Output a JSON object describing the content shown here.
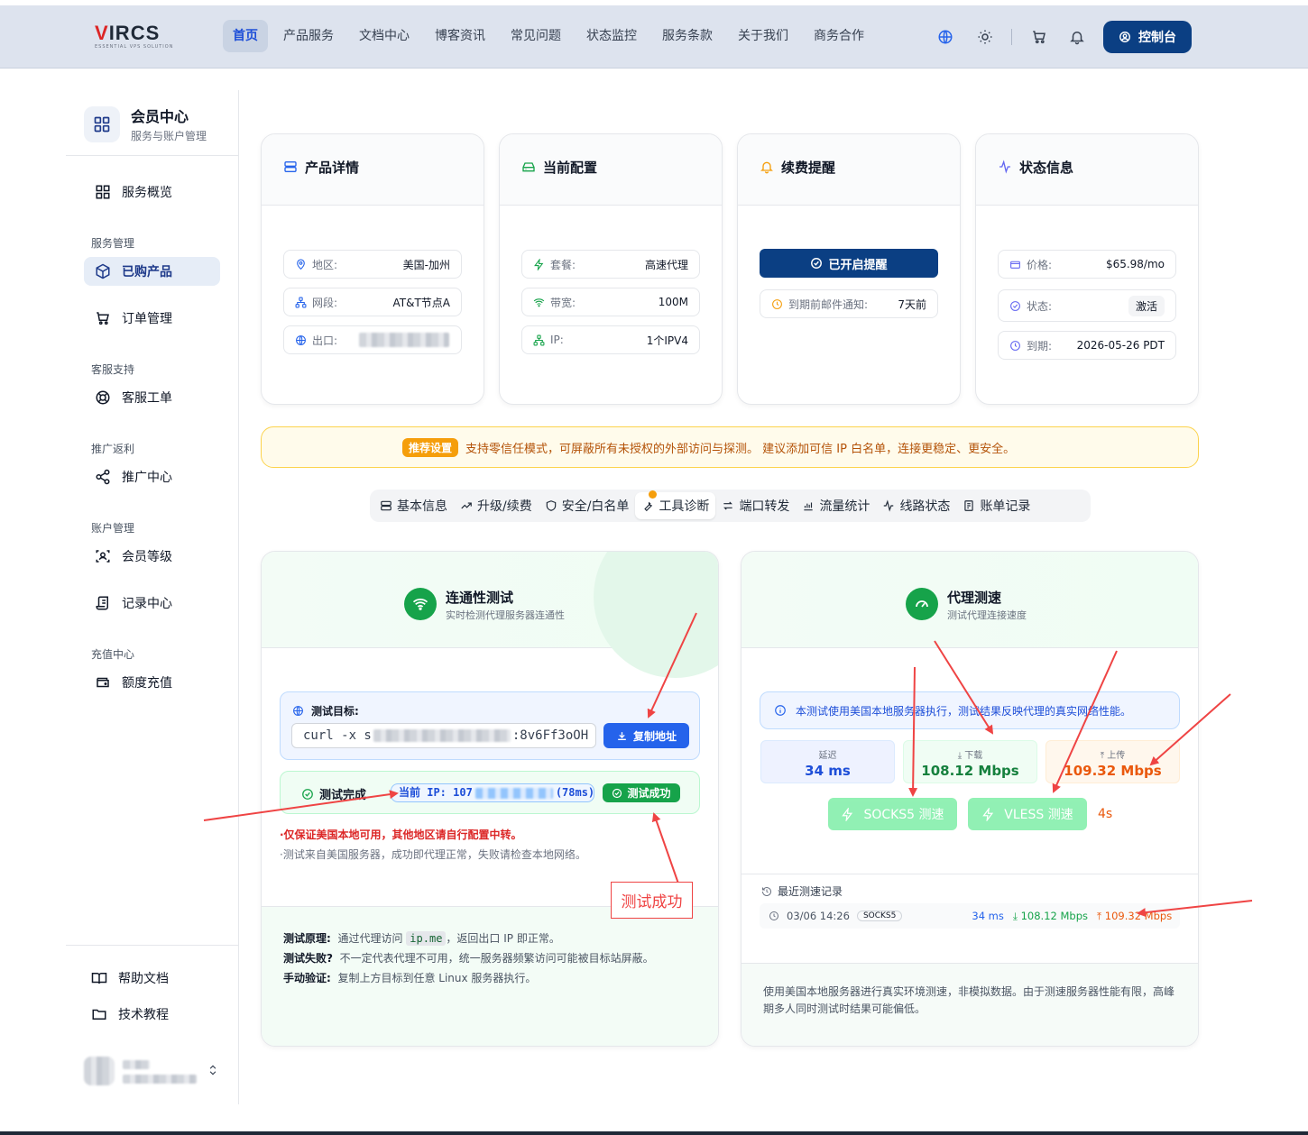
{
  "brand": {
    "name_prefix": "V",
    "name_rest": "IRCS",
    "tagline": "ESSENTIAL VPS SOLUTION"
  },
  "nav": [
    {
      "label": "首页",
      "active": true
    },
    {
      "label": "产品服务"
    },
    {
      "label": "文档中心"
    },
    {
      "label": "博客资讯"
    },
    {
      "label": "常见问题"
    },
    {
      "label": "状态监控"
    },
    {
      "label": "服务条款"
    },
    {
      "label": "关于我们"
    },
    {
      "label": "商务合作"
    }
  ],
  "header": {
    "console_label": "控制台",
    "icons": [
      "globe-icon",
      "sun-icon",
      "cart-icon",
      "bell-icon"
    ]
  },
  "sidebar": {
    "title": "会员中心",
    "subtitle": "服务与账户管理",
    "overview": "服务概览",
    "groups": {
      "service": "服务管理",
      "support": "客服支持",
      "promo": "推广返利",
      "account": "账户管理",
      "recharge": "充值中心"
    },
    "items": {
      "purchased": "已购产品",
      "orders": "订单管理",
      "tickets": "客服工单",
      "promo_center": "推广中心",
      "level": "会员等级",
      "records": "记录中心",
      "topup": "额度充值"
    },
    "bottom": {
      "help": "帮助文档",
      "tutorial": "技术教程"
    }
  },
  "cards": {
    "product": {
      "title": "产品详情",
      "rows": [
        {
          "label": "地区:",
          "value": "美国-加州"
        },
        {
          "label": "网段:",
          "value": "AT&T节点A"
        },
        {
          "label": "出口:",
          "value": ""
        }
      ]
    },
    "config": {
      "title": "当前配置",
      "rows": [
        {
          "label": "套餐:",
          "value": "高速代理"
        },
        {
          "label": "带宽:",
          "value": "100M"
        },
        {
          "label": "IP:",
          "value": "1个IPV4"
        }
      ]
    },
    "renew": {
      "title": "续费提醒",
      "button": "已开启提醒",
      "row": {
        "label": "到期前邮件通知:",
        "value": "7天前"
      }
    },
    "status": {
      "title": "状态信息",
      "rows": [
        {
          "label": "价格:",
          "value": "$65.98/mo"
        },
        {
          "label": "状态:",
          "value": "激活"
        },
        {
          "label": "到期:",
          "value": "2026-05-26 PDT"
        }
      ]
    }
  },
  "notice": {
    "tag": "推荐设置",
    "text": "支持零信任模式，可屏蔽所有未授权的外部访问与探测。 建议添加可信 IP 白名单，连接更稳定、更安全。"
  },
  "tabs": [
    {
      "label": "基本信息",
      "icon": "server-icon"
    },
    {
      "label": "升级/续费",
      "icon": "trend-icon"
    },
    {
      "label": "安全/白名单",
      "icon": "shield-icon"
    },
    {
      "label": "工具诊断",
      "icon": "wrench-icon",
      "active": true
    },
    {
      "label": "端口转发",
      "icon": "swap-icon"
    },
    {
      "label": "流量统计",
      "icon": "bar-icon"
    },
    {
      "label": "线路状态",
      "icon": "pulse-icon"
    },
    {
      "label": "账单记录",
      "icon": "receipt-icon"
    }
  ],
  "connectivity": {
    "title": "连通性测试",
    "subtitle": "实时检测代理服务器连通性",
    "target_label": "测试目标:",
    "command_prefix": "curl -x s",
    "command_suffix": ":8v6Ff3oOH",
    "copy_button": "复制地址",
    "done_label": "测试完成",
    "ip_prefix": "当前 IP: 107",
    "ip_suffix": "(78ms)",
    "success_badge": "测试成功",
    "warn_note": "·仅保证美国本地可用，其他地区请自行配置中转。",
    "info_note": "·测试来自美国服务器，成功即代理正常，失败请检查本地网络。",
    "principle_label": "测试原理:",
    "principle_pre": "通过代理访问",
    "principle_code": "ip.me",
    "principle_post": "，返回出口 IP 即正常。",
    "fail_label": "测试失败?",
    "fail_text": "不一定代表代理不可用，统一服务器频繁访问可能被目标站屏蔽。",
    "manual_label": "手动验证:",
    "manual_text": "复制上方目标到任意 Linux 服务器执行。"
  },
  "speedtest": {
    "title": "代理测速",
    "subtitle": "测试代理连接速度",
    "info": "本测试使用美国本地服务器执行，测试结果反映代理的真实网络性能。",
    "latency_label": "延迟",
    "latency_value": "34 ms",
    "download_label": "下载",
    "download_value": "108.12 Mbps",
    "upload_label": "上传",
    "upload_value": "109.32 Mbps",
    "socks_button": "SOCKS5 测速",
    "vless_button": "VLESS 测速",
    "countdown": "4s",
    "history_title": "最近测速记录",
    "history": [
      {
        "time": "03/06 14:26",
        "proto": "SOCKS5",
        "latency": "34 ms",
        "down": "108.12 Mbps",
        "up": "109.32 Mbps"
      }
    ],
    "disclaimer": "使用美国本地服务器进行真实环境测速，非模拟数据。由于测速服务器性能有限，高峰期多人同时测试时结果可能偏低。"
  },
  "annotation": {
    "label": "测试成功",
    "color": "#ef4444"
  },
  "colors": {
    "primary": "#0b3f83",
    "accent_blue": "#1d4ed8",
    "success": "#16a34a",
    "warning": "#f59e0b",
    "danger": "#dc2626",
    "upload": "#ea580c"
  }
}
